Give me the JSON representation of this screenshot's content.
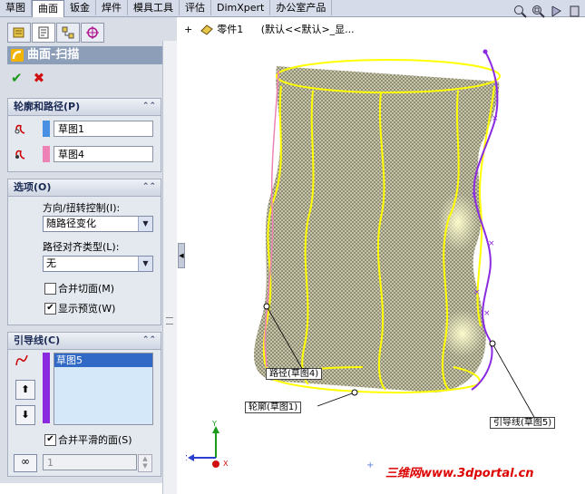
{
  "top_tabs": [
    "草图",
    "曲面",
    "钣金",
    "焊件",
    "模具工具",
    "评估",
    "DimXpert",
    "办公室产品"
  ],
  "active_tab_index": 1,
  "panel": {
    "title": "曲面-扫描",
    "help": "?",
    "ok": "✔",
    "cancel": "✖"
  },
  "sections": {
    "profile_path": {
      "title": "轮廓和路径(P)",
      "profile_value": "草图1",
      "profile_color": "#4a90e2",
      "path_value": "草图4",
      "path_color": "#ee82b6"
    },
    "options": {
      "title": "选项(O)",
      "orient_label": "方向/扭转控制(I):",
      "orient_value": "随路径变化",
      "align_label": "路径对齐类型(L):",
      "align_value": "无",
      "merge_tangent_label": "合并切面(M)",
      "merge_tangent_checked": false,
      "show_preview_label": "显示预览(W)",
      "show_preview_checked": true
    },
    "guides": {
      "title": "引导线(C)",
      "list": [
        "草图5"
      ],
      "list_color": "#8a2be2",
      "merge_smooth_label": "合并平滑的面(S)",
      "merge_smooth_checked": true,
      "spinner_value": "1"
    }
  },
  "tree": {
    "label": "零件1",
    "config": "(默认<<默认>_显..."
  },
  "callouts": {
    "path": "路径(草图4)",
    "profile": "轮廓(草图1)",
    "guide": "引导线(草图5)"
  },
  "triad": {
    "x": "X",
    "y": "Y",
    "z": "Z"
  },
  "watermark": "三维网www.3dportal.cn",
  "colors": {
    "accent_yellow": "#ffff00",
    "guide_purple": "#8a2be2",
    "path_pink": "#ee82b6",
    "title_bar": "#8d9eb9"
  }
}
